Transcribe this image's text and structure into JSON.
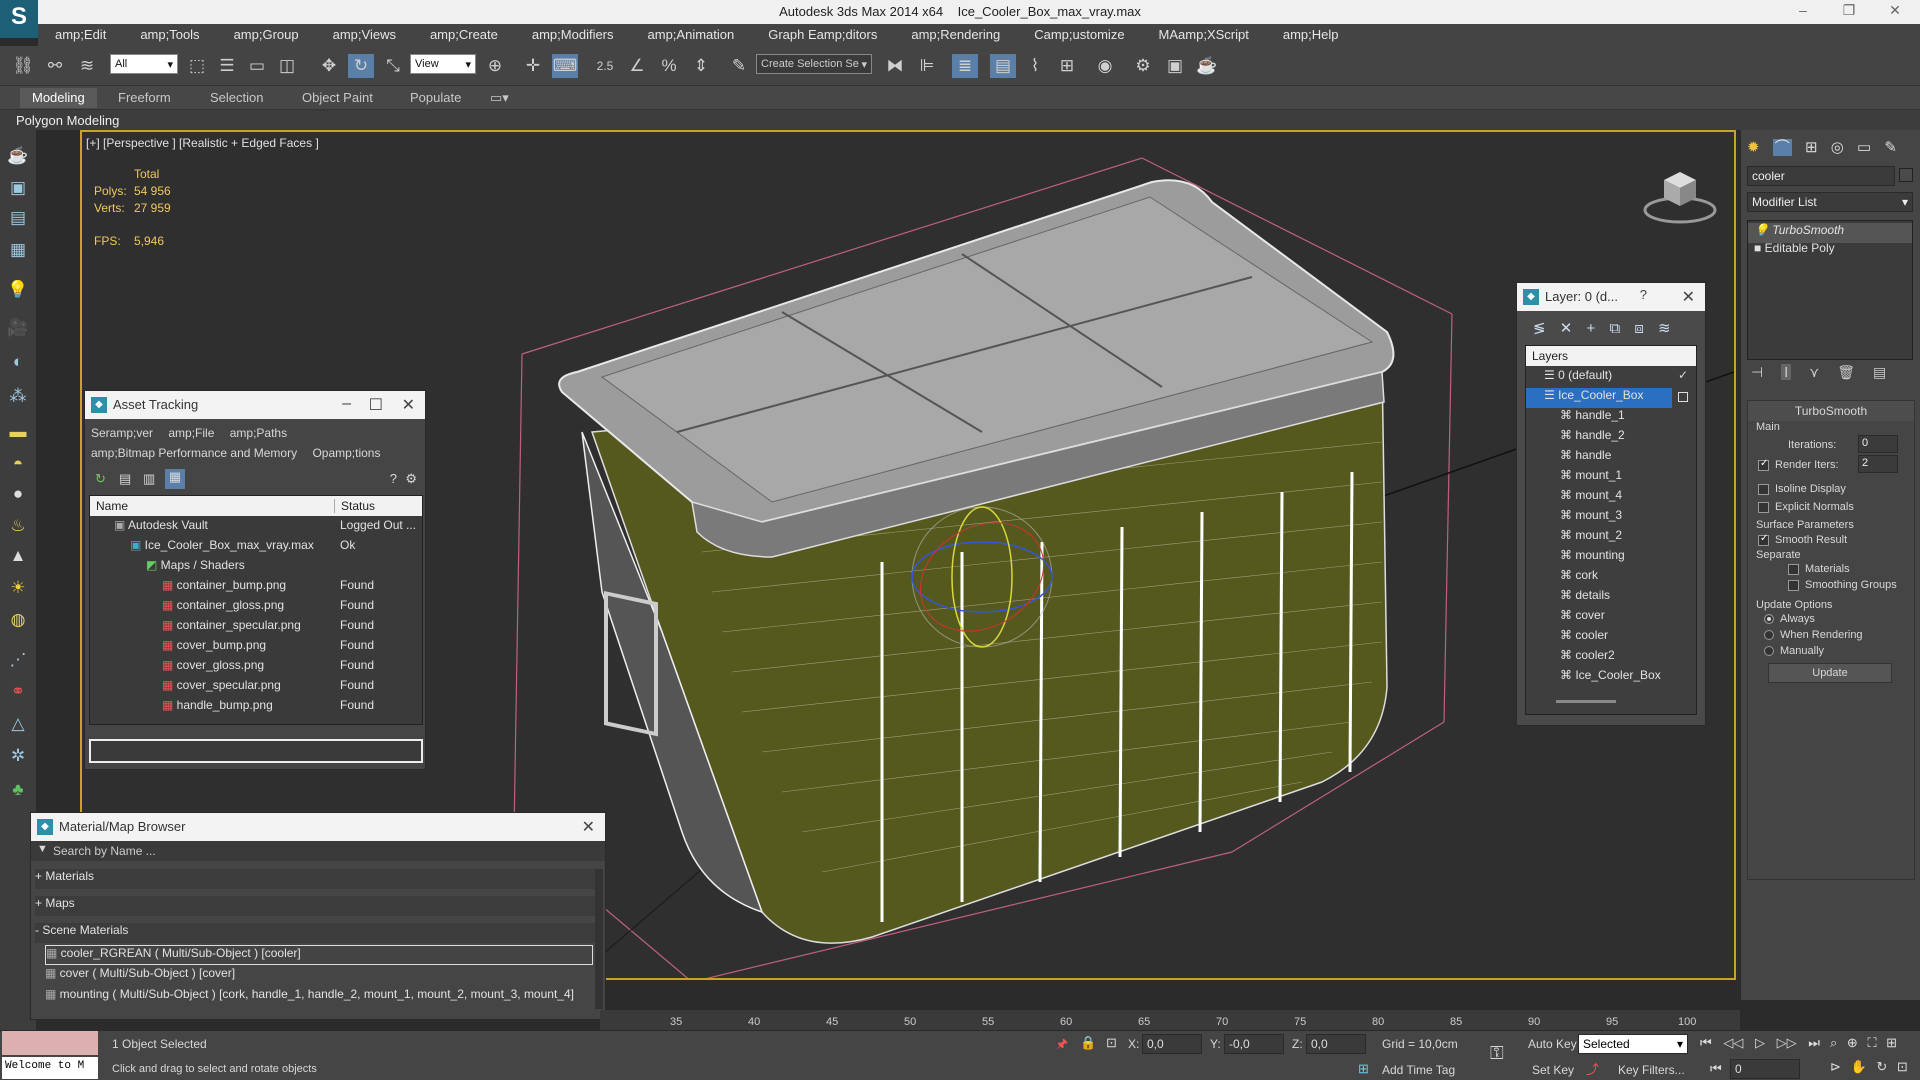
{
  "window": {
    "app_name": "Autodesk 3ds Max  2014 x64",
    "file_name": "Ice_Cooler_Box_max_vray.max",
    "logo_glyph": "S"
  },
  "menu": [
    "amp;Edit",
    "amp;Tools",
    "amp;Group",
    "amp;Views",
    "amp;Create",
    "amp;Modifiers",
    "amp;Animation",
    "Graph Eamp;ditors",
    "amp;Rendering",
    "Camp;ustomize",
    "MAamp;XScript",
    "amp;Help"
  ],
  "toolbar": {
    "selection_filter": "All",
    "ref_coord": "View",
    "named_selection": "Create Selection Se",
    "snap_value": "2.5"
  },
  "ribbon": {
    "tabs": [
      "Modeling",
      "Freeform",
      "Selection",
      "Object Paint",
      "Populate"
    ],
    "active": "Modeling",
    "sub_label": "Polygon Modeling"
  },
  "viewport": {
    "label": "[+] [Perspective ] [Realistic + Edged Faces ]",
    "stats": {
      "header": "Total",
      "polys_label": "Polys:",
      "polys_value": "54 956",
      "verts_label": "Verts:",
      "verts_value": "27 959",
      "fps_label": "FPS:",
      "fps_value": "5,946"
    },
    "accent_color": "#c9a227"
  },
  "asset_tracking": {
    "title": "Asset Tracking",
    "menus": [
      "Seramp;ver",
      "amp;File",
      "amp;Paths",
      "amp;Bitmap Performance and Memory",
      "Opamp;tions"
    ],
    "columns": [
      "Name",
      "Status"
    ],
    "rows": [
      {
        "name": "Autodesk Vault",
        "status": "Logged Out ..."
      },
      {
        "name": "Ice_Cooler_Box_max_vray.max",
        "status": "Ok"
      },
      {
        "name": "Maps / Shaders",
        "status": ""
      },
      {
        "name": "container_bump.png",
        "status": "Found"
      },
      {
        "name": "container_gloss.png",
        "status": "Found"
      },
      {
        "name": "container_specular.png",
        "status": "Found"
      },
      {
        "name": "cover_bump.png",
        "status": "Found"
      },
      {
        "name": "cover_gloss.png",
        "status": "Found"
      },
      {
        "name": "cover_specular.png",
        "status": "Found"
      },
      {
        "name": "handle_bump.png",
        "status": "Found"
      }
    ]
  },
  "material_browser": {
    "title": "Material/Map Browser",
    "search_placeholder": "Search by Name ...",
    "groups": [
      "+ Materials",
      "+ Maps",
      "- Scene Materials"
    ],
    "items": [
      "cooler_RGREAN  ( Multi/Sub-Object )  [cooler]",
      "cover  ( Multi/Sub-Object )  [cover]",
      "mounting  ( Multi/Sub-Object )  [cork, handle_1, handle_2, mount_1, mount_2, mount_3, mount_4]"
    ]
  },
  "layer_panel": {
    "title": "Layer: 0 (d...",
    "help": "?",
    "column": "Layers",
    "items": [
      "0 (default)",
      "Ice_Cooler_Box",
      "handle_1",
      "handle_2",
      "handle",
      "mount_1",
      "mount_4",
      "mount_3",
      "mount_2",
      "mounting",
      "cork",
      "details",
      "cover",
      "cooler",
      "cooler2",
      "Ice_Cooler_Box"
    ]
  },
  "command_panel": {
    "object_name": "cooler",
    "modifier_list": "Modifier List",
    "stack": [
      "TurboSmooth",
      "Editable Poly"
    ],
    "rollout_title": "TurboSmooth",
    "main_label": "Main",
    "iterations_label": "Iterations:",
    "iterations_value": "0",
    "render_iters_label": "Render Iters:",
    "render_iters_value": "2",
    "isoline": "Isoline Display",
    "explicit_normals": "Explicit Normals",
    "surface_params": "Surface Parameters",
    "smooth_result": "Smooth Result",
    "separate": "Separate",
    "materials": "Materials",
    "smoothing_groups": "Smoothing Groups",
    "update_options": "Update Options",
    "always": "Always",
    "when_rendering": "When Rendering",
    "manually": "Manually",
    "update_button": "Update"
  },
  "timeline": {
    "ticks": [
      "35",
      "40",
      "45",
      "50",
      "55",
      "60",
      "65",
      "70",
      "75",
      "80",
      "85",
      "90",
      "95",
      "100"
    ]
  },
  "status": {
    "maxscript": "Welcome to M",
    "selected": "1 Object Selected",
    "prompt": "Click and drag to select and rotate objects",
    "x_label": "X:",
    "x_value": "0,0",
    "y_label": "Y:",
    "y_value": "-0,0",
    "z_label": "Z:",
    "z_value": "0,0",
    "grid": "Grid = 10,0cm",
    "add_time_tag": "Add Time Tag",
    "auto_key": "Auto Key",
    "set_key": "Set Key",
    "key_mode": "Selected",
    "key_filters": "Key Filters...",
    "frame": "0"
  }
}
